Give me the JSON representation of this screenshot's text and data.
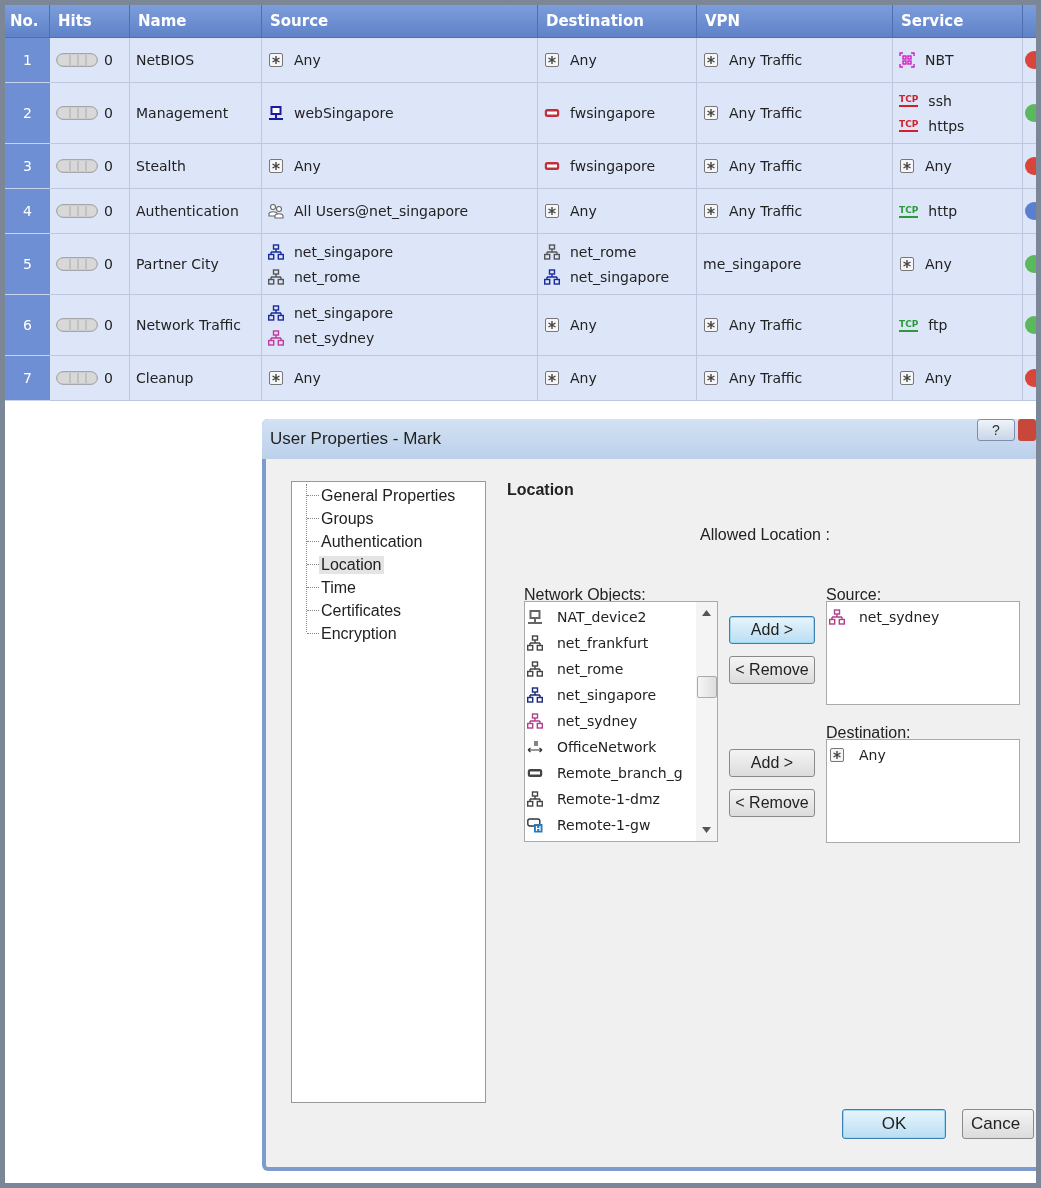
{
  "rule_table": {
    "columns": [
      "No.",
      "Hits",
      "Name",
      "Source",
      "Destination",
      "VPN",
      "Service"
    ],
    "rows": [
      {
        "no": "1",
        "hits": "0",
        "name": "NetBIOS",
        "source": [
          {
            "kind": "any",
            "text": "Any"
          }
        ],
        "destination": [
          {
            "kind": "any",
            "text": "Any"
          }
        ],
        "vpn": [
          {
            "kind": "any",
            "text": "Any Traffic"
          }
        ],
        "service": [
          {
            "kind": "nbt",
            "text": "NBT"
          }
        ],
        "action": {
          "color": "#d8453a"
        }
      },
      {
        "no": "2",
        "hits": "0",
        "name": "Management",
        "source": [
          {
            "kind": "host",
            "color": "#1a1aa0",
            "text": "webSingapore"
          }
        ],
        "destination": [
          {
            "kind": "gateway",
            "color": "#c0303a",
            "text": "fwsingapore"
          }
        ],
        "vpn": [
          {
            "kind": "any",
            "text": "Any Traffic"
          }
        ],
        "service": [
          {
            "kind": "tcp",
            "protocol": "TCP",
            "color": "#d0202a",
            "text": "ssh"
          },
          {
            "kind": "tcp",
            "protocol": "TCP",
            "color": "#d0202a",
            "text": "https"
          }
        ],
        "action": {
          "color": "#5cb85c"
        }
      },
      {
        "no": "3",
        "hits": "0",
        "name": "Stealth",
        "source": [
          {
            "kind": "any",
            "text": "Any"
          }
        ],
        "destination": [
          {
            "kind": "gateway",
            "color": "#c0303a",
            "text": "fwsingapore"
          }
        ],
        "vpn": [
          {
            "kind": "any",
            "text": "Any Traffic"
          }
        ],
        "service": [
          {
            "kind": "any",
            "text": "Any"
          }
        ],
        "action": {
          "color": "#d8453a"
        }
      },
      {
        "no": "4",
        "hits": "0",
        "name": "Authentication",
        "source": [
          {
            "kind": "users",
            "text": "All Users@net_singapore"
          }
        ],
        "destination": [
          {
            "kind": "any",
            "text": "Any"
          }
        ],
        "vpn": [
          {
            "kind": "any",
            "text": "Any Traffic"
          }
        ],
        "service": [
          {
            "kind": "tcp",
            "protocol": "TCP",
            "color": "#2a9a3a",
            "text": "http"
          }
        ],
        "action": {
          "color": "#5a7fd0"
        }
      },
      {
        "no": "5",
        "hits": "0",
        "name": "Partner City",
        "source": [
          {
            "kind": "network",
            "color": "#1a2a9a",
            "text": "net_singapore"
          },
          {
            "kind": "network",
            "color": "#555555",
            "text": "net_rome"
          }
        ],
        "destination": [
          {
            "kind": "network",
            "color": "#555555",
            "text": "net_rome"
          },
          {
            "kind": "network",
            "color": "#1a2a9a",
            "text": "net_singapore"
          }
        ],
        "vpn": [
          {
            "kind": "none",
            "text": "me_singapore"
          }
        ],
        "service": [
          {
            "kind": "any",
            "text": "Any"
          }
        ],
        "action": {
          "color": "#5cb85c"
        }
      },
      {
        "no": "6",
        "hits": "0",
        "name": "Network Traffic",
        "source": [
          {
            "kind": "network",
            "color": "#1a2a9a",
            "text": "net_singapore"
          },
          {
            "kind": "network",
            "color": "#c03a9a",
            "text": "net_sydney"
          }
        ],
        "destination": [
          {
            "kind": "any",
            "text": "Any"
          }
        ],
        "vpn": [
          {
            "kind": "any",
            "text": "Any Traffic"
          }
        ],
        "service": [
          {
            "kind": "tcp",
            "protocol": "TCP",
            "color": "#2a9a3a",
            "text": "ftp"
          }
        ],
        "action": {
          "color": "#5cb85c"
        }
      },
      {
        "no": "7",
        "hits": "0",
        "name": "Cleanup",
        "source": [
          {
            "kind": "any",
            "text": "Any"
          }
        ],
        "destination": [
          {
            "kind": "any",
            "text": "Any"
          }
        ],
        "vpn": [
          {
            "kind": "any",
            "text": "Any Traffic"
          }
        ],
        "service": [
          {
            "kind": "any",
            "text": "Any"
          }
        ],
        "action": {
          "color": "#d8453a"
        }
      }
    ]
  },
  "dialog": {
    "title": "User Properties - Mark",
    "help_button": "?",
    "tree": [
      {
        "label": "General Properties",
        "selected": false
      },
      {
        "label": "Groups",
        "selected": false
      },
      {
        "label": "Authentication",
        "selected": false
      },
      {
        "label": "Location",
        "selected": true
      },
      {
        "label": "Time",
        "selected": false
      },
      {
        "label": "Certificates",
        "selected": false
      },
      {
        "label": "Encryption",
        "selected": false
      }
    ],
    "section_title": "Location",
    "allowed_label": "Allowed Location :",
    "network_objects_label": "Network Objects:",
    "network_objects": [
      {
        "kind": "host",
        "color": "#666666",
        "text": "NAT_device2"
      },
      {
        "kind": "network",
        "color": "#444444",
        "text": "net_frankfurt"
      },
      {
        "kind": "network",
        "color": "#444444",
        "text": "net_rome"
      },
      {
        "kind": "network",
        "color": "#1a2a7a",
        "text": "net_singapore"
      },
      {
        "kind": "network",
        "color": "#b0408a",
        "text": "net_sydney"
      },
      {
        "kind": "ip",
        "text": "OfficeNetwork"
      },
      {
        "kind": "gateway",
        "color": "#444444",
        "text": "Remote_branch_g"
      },
      {
        "kind": "network",
        "color": "#444444",
        "text": "Remote-1-dmz"
      },
      {
        "kind": "cluster",
        "text": "Remote-1-gw"
      }
    ],
    "source_label": "Source:",
    "source": [
      {
        "kind": "network",
        "color": "#b0408a",
        "text": "net_sydney"
      }
    ],
    "destination_label": "Destination:",
    "destination": [
      {
        "kind": "any",
        "text": "Any"
      }
    ],
    "add_buttons": [
      {
        "label": "Add >",
        "focused": true
      },
      {
        "label": "Add >",
        "focused": false
      }
    ],
    "remove_buttons": [
      "< Remove",
      "< Remove"
    ],
    "ok_button": "OK",
    "cancel_button": "Cance"
  }
}
